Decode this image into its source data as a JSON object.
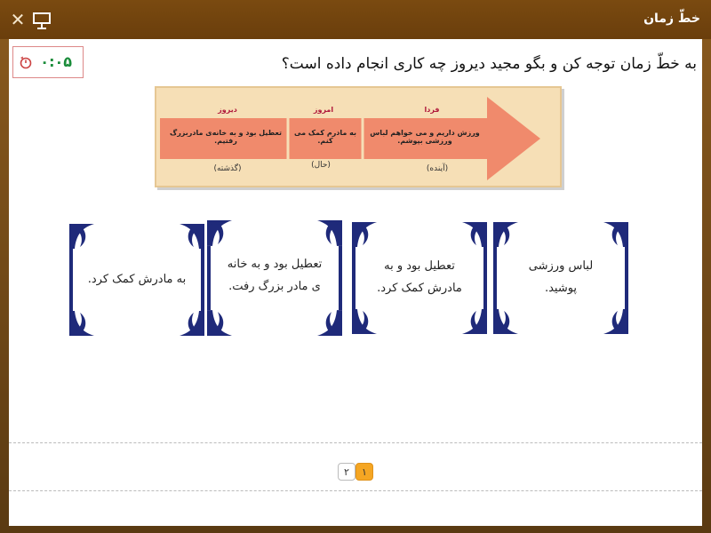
{
  "window": {
    "title": "خطّ زمان"
  },
  "timer": {
    "value": "۰:۰۵"
  },
  "question": "به خطّ زمان توجه کن و بگو مجید دیروز چه کاری انجام داده است؟",
  "reference": {
    "labels": {
      "past": "دیروز",
      "present": "امروز",
      "future": "فردا"
    },
    "texts": {
      "past": "تعطیل بود و به خانه‌ی مادربزرگ رفتیم.",
      "present": "به مادرم کمک می کنم.",
      "future": "ورزش داریم و می خواهم لباس ورزشی بپوشم."
    },
    "captions": {
      "past": "(گذشته)",
      "present": "(حال)",
      "future": "(آینده)"
    }
  },
  "cards": [
    {
      "text": "لباس ورزشی پوشید."
    },
    {
      "text": "تعطیل بود و به مادرش کمک کرد."
    },
    {
      "text": "تعطیل بود و به خانه ی مادر بزرگ رفت."
    },
    {
      "text": "به مادرش کمک کرد."
    }
  ],
  "pager": {
    "pages": [
      "۱",
      "۲"
    ],
    "current": "۱"
  },
  "colors": {
    "title_bar": "#6a3e0c",
    "timer": "#1a8c3a",
    "frame": "#1f2a7a",
    "arrow": "#f08a6c",
    "pager_active": "#f5a623"
  }
}
